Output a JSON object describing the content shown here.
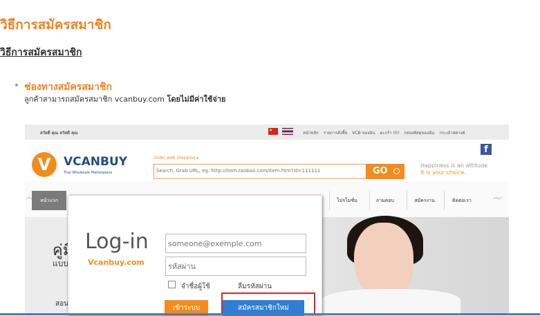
{
  "page": {
    "title": "วิธีการสมัครสมาชิก",
    "subtitle": "วิธีการสมัครสมาชิก",
    "section_heading": "ช่องทางสมัครสมาชิก",
    "section_desc": "ลูกค้าสามารถสมัครสมาชิก vcanbuy.com",
    "section_desc_bold": "โดยไม่มีค่าใช้จ่าย"
  },
  "screenshot": {
    "topbar": {
      "greeting": "สวัสดี คุณ สวัสดี คุณ",
      "links": [
        "หน้าหลัก",
        "รายการสั่งซื้อ",
        "VCB ของฉัน",
        "ตะกร้า (0)",
        "กล่องพัสดุของฉัน",
        "กระเป๋าสตางค์"
      ]
    },
    "header": {
      "logo_letter": "V",
      "logo_text": "VCANBUY",
      "logo_sub": "Thai Wholesale Marketplace",
      "order_label": "Order web shopping ▸",
      "search_placeholder": "Search, Grab URL, eg: http://item.taobao.com/item.htm?id=111111",
      "go_label": "GO",
      "facebook_letter": "f",
      "slogan_line1": "Happiness is an attitude",
      "slogan_line2": "It is your choice."
    },
    "nav": {
      "home": "หน้าแรก",
      "items": [
        "โปรโมชั่น",
        "ถามตอบ",
        "สมัครงาน",
        "ติดต่อเรา"
      ]
    },
    "banner": {
      "text1": "คู่มื",
      "text2": "แบบ",
      "text3": "สอน"
    },
    "login_modal": {
      "title": "Log-in",
      "subtitle": "Vcanbuy.com",
      "email_placeholder": "someone@exemple.com",
      "password_placeholder": "รหัสผ่าน",
      "remember_label": "จำชื่อผู้ใช้",
      "forgot_label": "ลืมรหัสผ่าน",
      "login_button": "เข้าระบบ",
      "register_button": "สมัครสมาชิกใหม่"
    }
  },
  "colors": {
    "accent_orange": "#f0821e",
    "brand_blue": "#234d8a",
    "register_blue": "#2e7ed5",
    "highlight_red": "#d9252a"
  }
}
